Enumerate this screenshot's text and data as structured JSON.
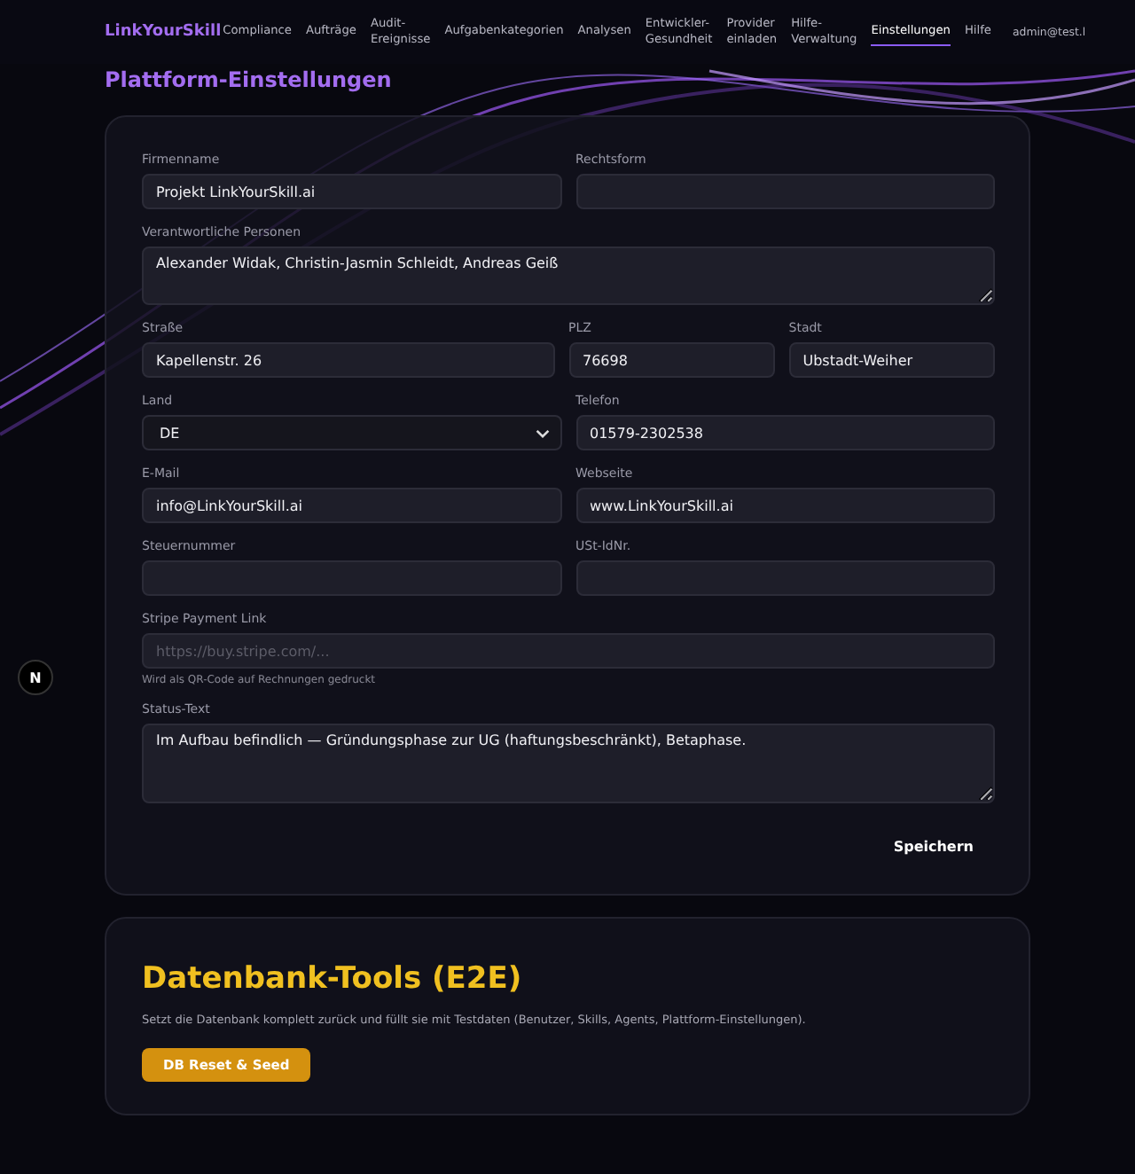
{
  "nav": {
    "logo": "LinkYourSkill",
    "items": [
      {
        "label": "Compliance",
        "selected": false
      },
      {
        "label": "Aufträge",
        "selected": false
      },
      {
        "label": "Audit-\nEreignisse",
        "selected": false
      },
      {
        "label": "Aufgabenkategorien",
        "selected": false
      },
      {
        "label": "Analysen",
        "selected": false
      },
      {
        "label": "Entwickler-\nGesundheit",
        "selected": false
      },
      {
        "label": "Provider\neinladen",
        "selected": false
      },
      {
        "label": "Hilfe-\nVerwaltung",
        "selected": false
      },
      {
        "label": "Einstellungen",
        "selected": true
      },
      {
        "label": "Hilfe",
        "selected": false
      }
    ],
    "user": "admin@test.l"
  },
  "page_title": "Plattform-Einstellungen",
  "form": {
    "rows": [
      [
        {
          "kind": "input",
          "label": "Firmenname",
          "value": "Projekt LinkYourSkill.ai"
        },
        {
          "kind": "input",
          "label": "Rechtsform"
        }
      ],
      [
        {
          "kind": "textarea",
          "label": "Verantwortliche Personen",
          "value": "Alexander Widak, Christin-Jasmin Schleidt, Andreas Geiß"
        }
      ],
      [
        {
          "kind": "input",
          "label": "Straße",
          "value": "Kapellenstr. 26"
        },
        {
          "kind": "input",
          "label": "PLZ",
          "value": "76698"
        },
        {
          "kind": "input",
          "label": "Stadt",
          "value": "Ubstadt-Weiher"
        }
      ],
      [
        {
          "kind": "select",
          "label": "Land",
          "value": "DE"
        },
        {
          "kind": "input",
          "label": "Telefon",
          "value": "01579-2302538"
        }
      ],
      [
        {
          "kind": "input",
          "label": "E-Mail",
          "value": "info@LinkYourSkill.ai"
        },
        {
          "kind": "input",
          "label": "Webseite",
          "value": "www.LinkYourSkill.ai"
        }
      ],
      [
        {
          "kind": "input",
          "label": "Steuernummer"
        },
        {
          "kind": "input",
          "label": "USt-IdNr."
        }
      ],
      [
        {
          "kind": "input",
          "label": "Stripe Payment Link",
          "placeholder": "https://buy.stripe.com/...",
          "hint": "Wird als QR-Code auf Rechnungen gedruckt"
        }
      ],
      [
        {
          "kind": "bigtextarea",
          "label": "Status-Text",
          "value": "Im Aufbau befindlich — Gründungsphase zur UG (haftungsbeschränkt), Betaphase."
        }
      ]
    ],
    "save_button": "Speichern"
  },
  "db_tools": {
    "title": "Datenbank-Tools (E2E)",
    "description": "Setzt die Datenbank komplett zurück und füllt sie mit Testdaten (Benutzer, Skills, Agents, Plattform-Einstellungen).",
    "button": "DB Reset & Seed"
  },
  "dev_badge": "N"
}
